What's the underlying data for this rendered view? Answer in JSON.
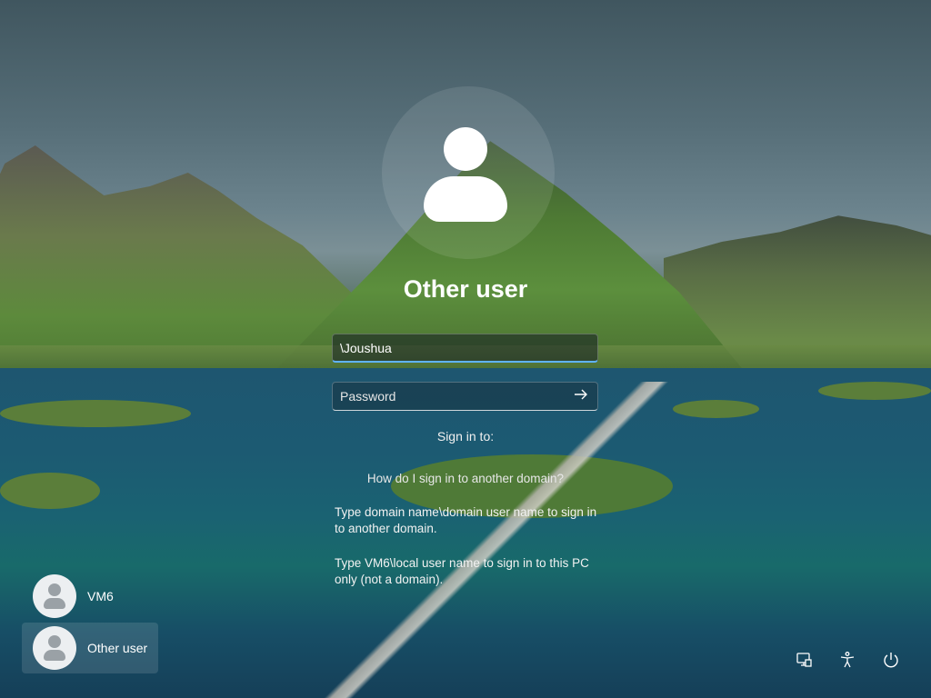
{
  "login": {
    "title": "Other user",
    "username_value": "\\Joushua",
    "password_placeholder": "Password",
    "sign_in_to_label": "Sign in to:",
    "help_link": "How do I sign in to another domain?",
    "help_text_1": "Type domain name\\domain user name to sign in to another domain.",
    "help_text_2": "Type VM6\\local user name to sign in to this PC only (not a domain).",
    "submit_icon": "arrow-right-icon"
  },
  "users": [
    {
      "name": "VM6",
      "icon": "user-avatar-icon"
    },
    {
      "name": "Other user",
      "icon": "user-avatar-icon"
    }
  ],
  "system_icons": [
    "network-icon",
    "accessibility-icon",
    "power-icon"
  ],
  "colors": {
    "focus_accent": "#5fb2ff"
  }
}
